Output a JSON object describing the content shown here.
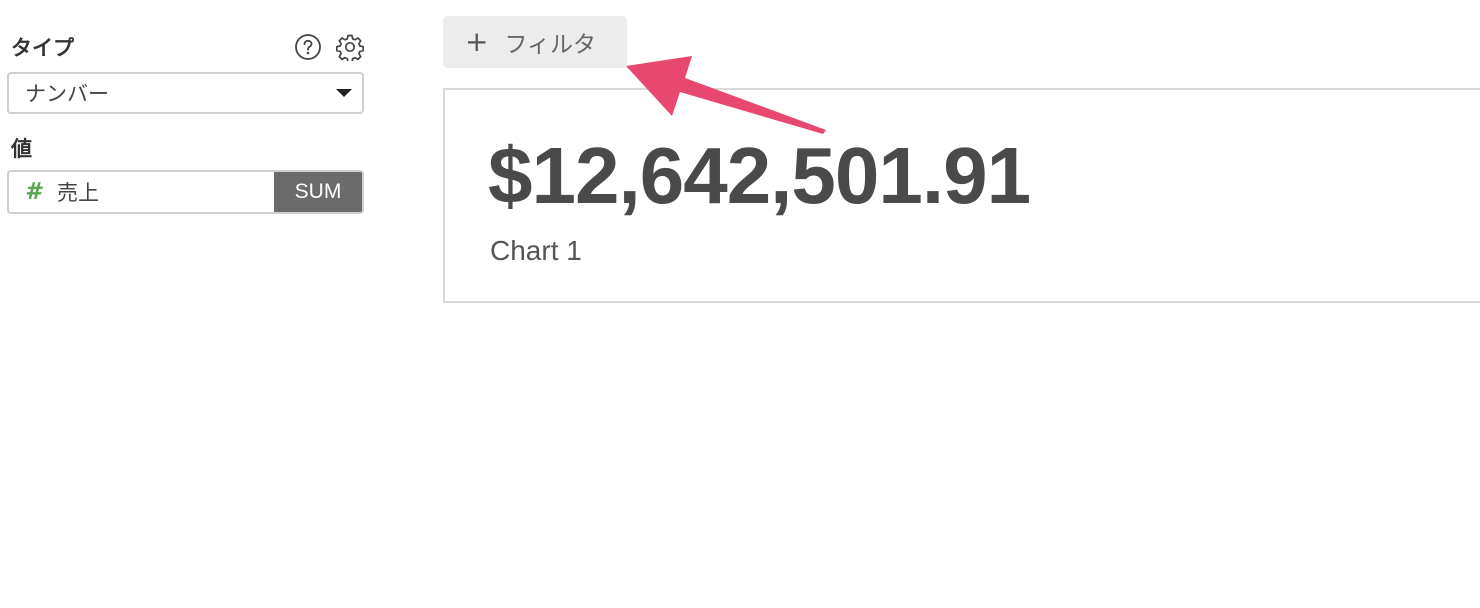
{
  "panel": {
    "type_label": "タイプ",
    "type_select_value": "ナンバー",
    "value_label": "値",
    "value_field": {
      "name": "売上",
      "type_icon": "hash-icon",
      "aggregation": "SUM"
    },
    "icons": [
      "help-circle-icon",
      "gear-icon"
    ]
  },
  "filter": {
    "label": "フィルタ",
    "icon": "plus-icon"
  },
  "card": {
    "value": "$12,642,501.91",
    "title": "Chart 1"
  },
  "colors": {
    "hash_icon": "#5aa552",
    "aggregation_bg": "#6b6b6b",
    "annotation_arrow": "#e8476f",
    "filter_bg": "#ececec"
  }
}
